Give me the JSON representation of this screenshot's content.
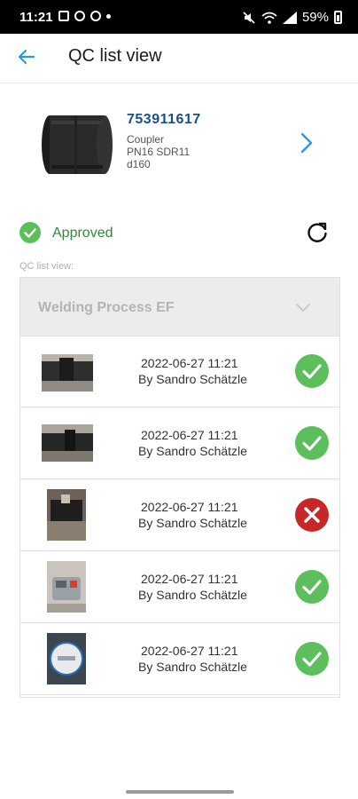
{
  "status_bar": {
    "time": "11:21",
    "battery": "59%"
  },
  "header": {
    "title": "QC list view",
    "back_icon": "arrow-left-icon"
  },
  "product": {
    "code": "753911617",
    "line1": "Coupler",
    "line2": "PN16 SDR11",
    "line3": "d160",
    "chevron_icon": "chevron-right-icon"
  },
  "status": {
    "label": "Approved",
    "icon": "check-circle-icon",
    "refresh_icon": "refresh-icon"
  },
  "qc_list": {
    "caption": "QC list view:",
    "dropdown_label": "Welding Process EF",
    "items": [
      {
        "date": "2022-06-27 11:21",
        "by": "By Sandro Schätzle",
        "result": "pass"
      },
      {
        "date": "2022-06-27 11:21",
        "by": "By Sandro Schätzle",
        "result": "pass"
      },
      {
        "date": "2022-06-27 11:21",
        "by": "By Sandro Schätzle",
        "result": "fail"
      },
      {
        "date": "2022-06-27 11:21",
        "by": "By Sandro Schätzle",
        "result": "pass"
      },
      {
        "date": "2022-06-27 11:21",
        "by": "By Sandro Schätzle",
        "result": "pass"
      }
    ]
  },
  "colors": {
    "accent": "#2a9ad8",
    "pass": "#5cbf5c",
    "fail": "#c62828",
    "product_code": "#1a4f8e"
  }
}
